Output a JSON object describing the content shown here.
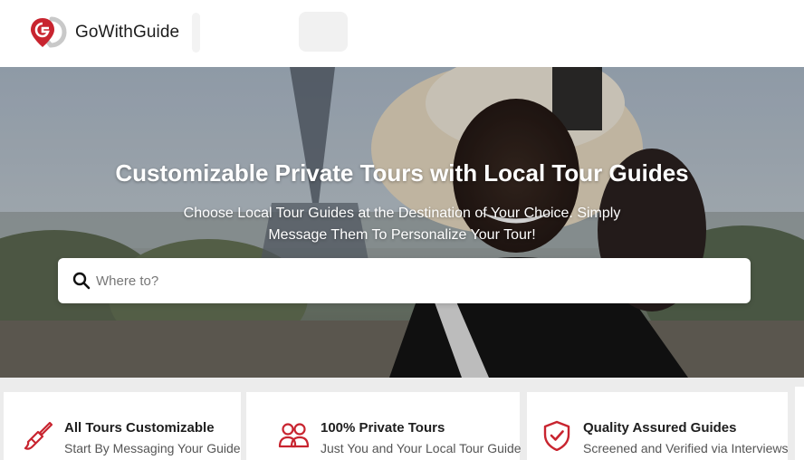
{
  "brand": {
    "name": "GoWithGuide",
    "accent": "#c8242f"
  },
  "hero": {
    "title": "Customizable Private Tours with Local Tour Guides",
    "subtitle": "Choose Local Tour Guides at the Destination of Your Choice. Simply Message Them To Personalize Your Tour!"
  },
  "search": {
    "placeholder": "Where to?",
    "icon": "search-icon"
  },
  "features": [
    {
      "icon": "paintbrush-icon",
      "title": "All Tours Customizable",
      "subtitle": "Start By Messaging Your Guide"
    },
    {
      "icon": "people-icon",
      "title": "100% Private Tours",
      "subtitle": "Just You and Your Local Tour Guide"
    },
    {
      "icon": "shield-check-icon",
      "title": "Quality Assured Guides",
      "subtitle": "Screened and Verified via Interviews"
    }
  ]
}
